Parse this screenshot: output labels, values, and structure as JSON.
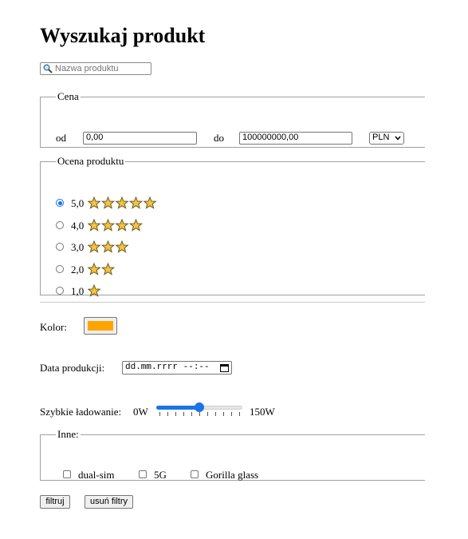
{
  "title": "Wyszukaj produkt",
  "search": {
    "placeholder": "Nazwa produktu"
  },
  "price": {
    "legend": "Cena",
    "from_label": "od",
    "from_value": "0,00",
    "to_label": "do",
    "to_value": "100000000,00",
    "currency": "PLN"
  },
  "rating": {
    "legend": "Ocena produktu",
    "options": [
      {
        "label": "5,0",
        "stars": 5,
        "selected": true
      },
      {
        "label": "4,0",
        "stars": 4,
        "selected": false
      },
      {
        "label": "3,0",
        "stars": 3,
        "selected": false
      },
      {
        "label": "2,0",
        "stars": 2,
        "selected": false
      },
      {
        "label": "1,0",
        "stars": 1,
        "selected": false
      }
    ]
  },
  "color": {
    "label": "Kolor:",
    "value": "#FFA500"
  },
  "production_date": {
    "label": "Data produkcji:",
    "placeholder": "dd.mm.rrrr --:--"
  },
  "fast_charging": {
    "label": "Szybkie ładowanie:",
    "min_label": "0W",
    "max_label": "150W",
    "level": 0.5
  },
  "other": {
    "legend": "Inne:",
    "options": [
      {
        "label": "dual-sim",
        "checked": false
      },
      {
        "label": "5G",
        "checked": false
      },
      {
        "label": "Gorilla glass",
        "checked": false
      }
    ]
  },
  "buttons": {
    "filter": "filtruj",
    "clear": "usuń filtry"
  },
  "colors": {
    "accent": "#1a73e8",
    "star_fill": "#F5C242",
    "star_stroke": "#6B5A1E"
  }
}
